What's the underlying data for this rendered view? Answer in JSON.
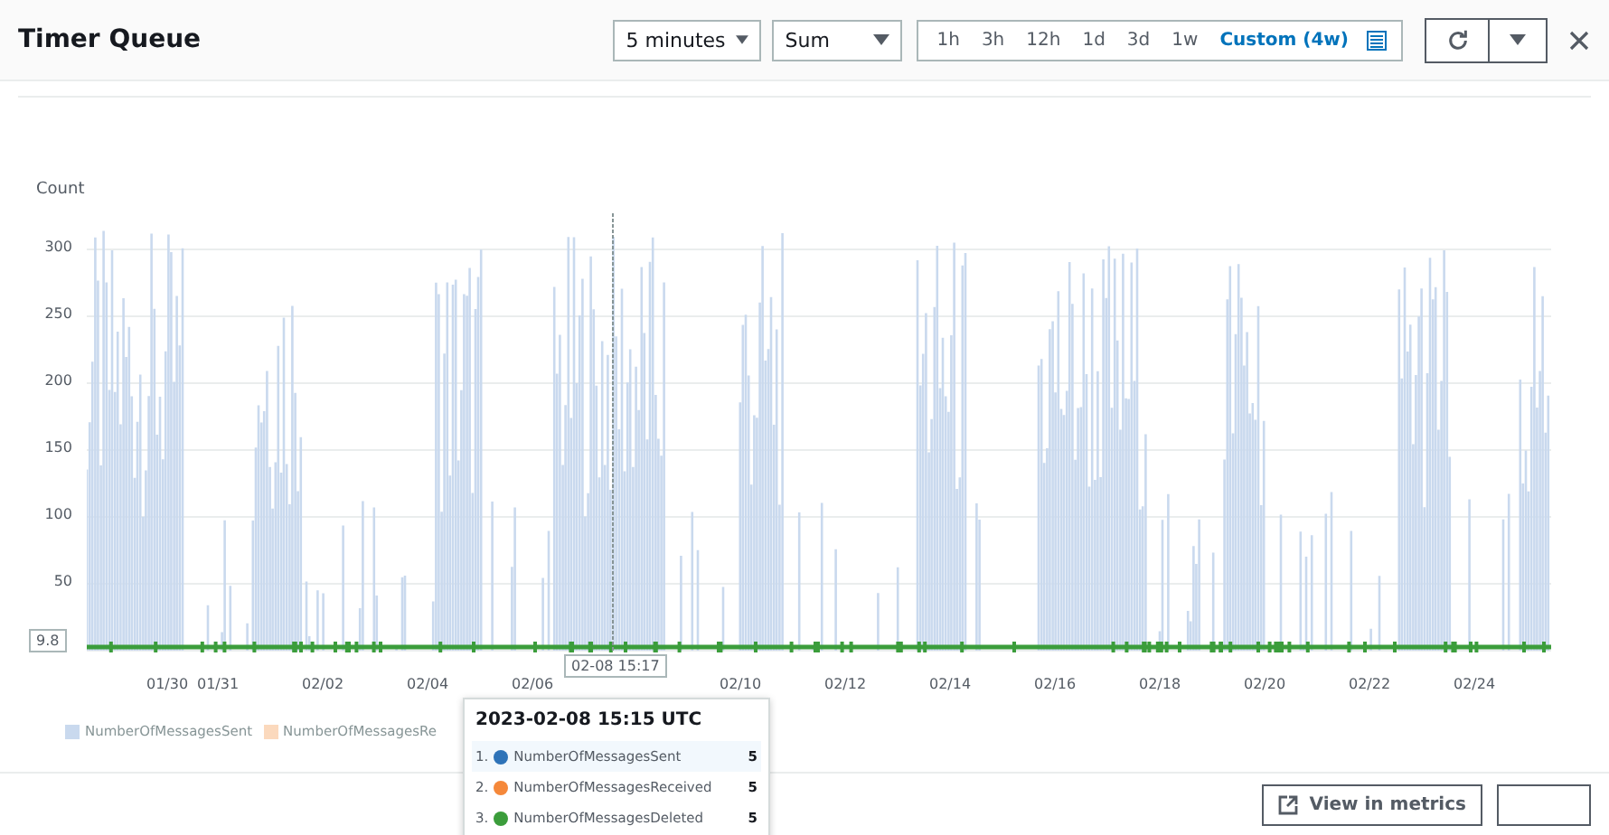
{
  "title": "Timer Queue",
  "period": {
    "value": "5 minutes"
  },
  "statistic": {
    "value": "Sum"
  },
  "ranges": [
    {
      "label": "1h",
      "selected": false
    },
    {
      "label": "3h",
      "selected": false
    },
    {
      "label": "12h",
      "selected": false
    },
    {
      "label": "1d",
      "selected": false
    },
    {
      "label": "3d",
      "selected": false
    },
    {
      "label": "1w",
      "selected": false
    },
    {
      "label": "Custom (4w)",
      "selected": true
    }
  ],
  "y_label": "Count",
  "y_ticks": [
    "300",
    "250",
    "200",
    "150",
    "100",
    "50"
  ],
  "y_cursor": "9.8",
  "x_ticks": [
    "01/30",
    "01/31",
    "02/02",
    "02/04",
    "02/06",
    "02/10",
    "02/12",
    "02/14",
    "02/16",
    "02/18",
    "02/20",
    "02/22",
    "02/24"
  ],
  "x_cursor": "02-08 15:17",
  "legend": [
    {
      "label": "NumberOfMessagesSent",
      "color": "#c9d9ee"
    },
    {
      "label": "NumberOfMessagesRe",
      "color": "#fbd9bd"
    }
  ],
  "tooltip": {
    "title": "2023-02-08 15:15 UTC",
    "rows": [
      {
        "index": "1.",
        "name": "NumberOfMessagesSent",
        "value": "5",
        "color": "#2e73b8",
        "selected": true
      },
      {
        "index": "2.",
        "name": "NumberOfMessagesReceived",
        "value": "5",
        "color": "#f5883a",
        "selected": false
      },
      {
        "index": "3.",
        "name": "NumberOfMessagesDeleted",
        "value": "5",
        "color": "#3b9d3b",
        "selected": false
      }
    ]
  },
  "footer": {
    "link_button": "View in metrics"
  }
}
